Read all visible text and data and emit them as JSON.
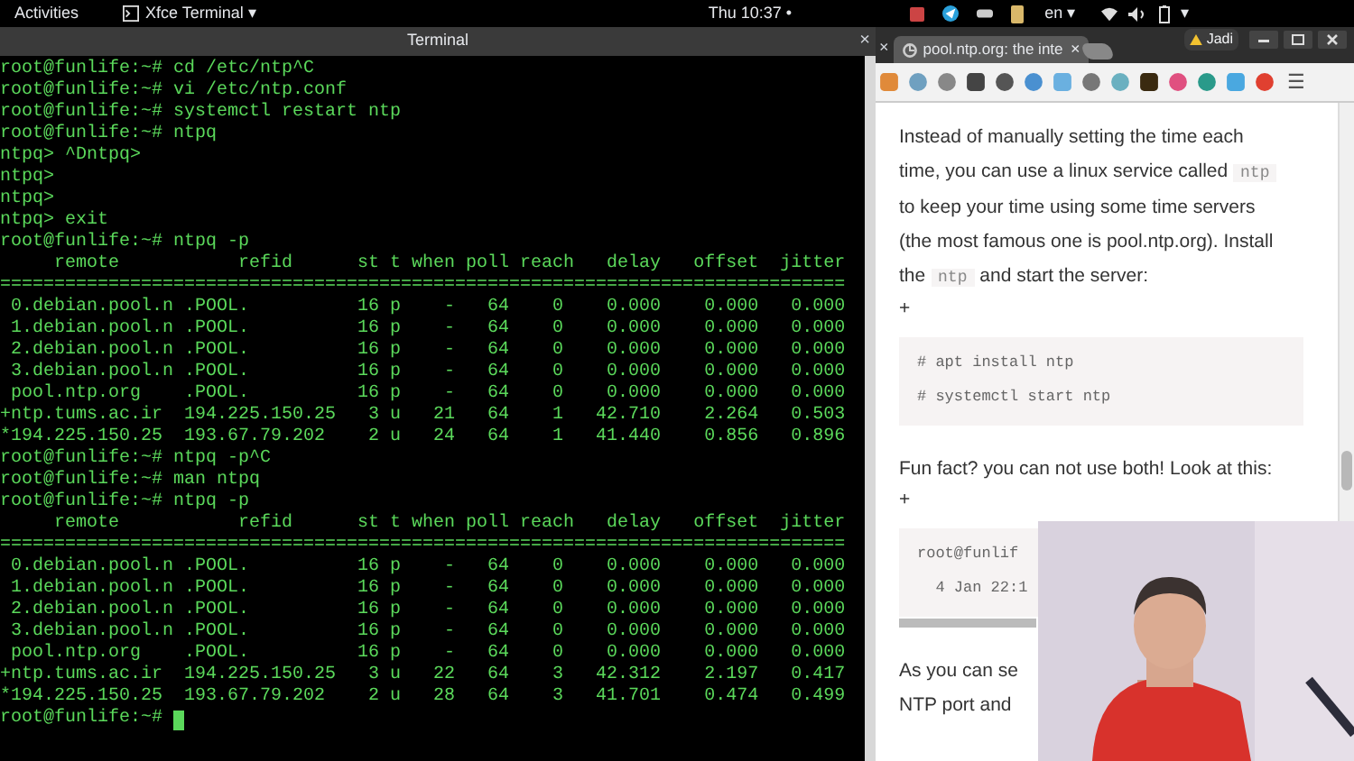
{
  "top_bar": {
    "activities": "Activities",
    "app_menu": "Xfce Terminal ▾",
    "clock": "Thu 10:37 •",
    "language": "en ▾",
    "system_menu": "▾"
  },
  "terminal": {
    "title": "Terminal",
    "close": "×",
    "lines": [
      "root@funlife:~# cd /etc/ntp^C",
      "root@funlife:~# vi /etc/ntp.conf",
      "root@funlife:~# systemctl restart ntp",
      "root@funlife:~# ntpq",
      "ntpq> ^Dntpq>",
      "ntpq>",
      "ntpq>",
      "ntpq> exit",
      "root@funlife:~# ntpq -p",
      "     remote           refid      st t when poll reach   delay   offset  jitter",
      "==============================================================================",
      " 0.debian.pool.n .POOL.          16 p    -   64    0    0.000    0.000   0.000",
      " 1.debian.pool.n .POOL.          16 p    -   64    0    0.000    0.000   0.000",
      " 2.debian.pool.n .POOL.          16 p    -   64    0    0.000    0.000   0.000",
      " 3.debian.pool.n .POOL.          16 p    -   64    0    0.000    0.000   0.000",
      " pool.ntp.org    .POOL.          16 p    -   64    0    0.000    0.000   0.000",
      "+ntp.tums.ac.ir  194.225.150.25   3 u   21   64    1   42.710    2.264   0.503",
      "*194.225.150.25  193.67.79.202    2 u   24   64    1   41.440    0.856   0.896",
      "root@funlife:~# ntpq -p^C",
      "root@funlife:~# man ntpq",
      "root@funlife:~# ntpq -p",
      "     remote           refid      st t when poll reach   delay   offset  jitter",
      "==============================================================================",
      " 0.debian.pool.n .POOL.          16 p    -   64    0    0.000    0.000   0.000",
      " 1.debian.pool.n .POOL.          16 p    -   64    0    0.000    0.000   0.000",
      " 2.debian.pool.n .POOL.          16 p    -   64    0    0.000    0.000   0.000",
      " 3.debian.pool.n .POOL.          16 p    -   64    0    0.000    0.000   0.000",
      " pool.ntp.org    .POOL.          16 p    -   64    0    0.000    0.000   0.000",
      "+ntp.tums.ac.ir  194.225.150.25   3 u   22   64    3   42.312    2.197   0.417",
      "*194.225.150.25  193.67.79.202    2 u   28   64    3   41.701    0.474   0.499"
    ],
    "prompt": "root@funlife:~# "
  },
  "browser": {
    "profile": "Jadi",
    "tab_close_left": "×",
    "tabs": [
      {
        "label": "pool.ntp.org: the inte",
        "close": "×",
        "selected": true
      }
    ],
    "menu": "☰",
    "content": [
      {
        "kind": "paragraph",
        "segments": [
          {
            "text": "Instead of manually setting the time each\ntime, you can use a linux service called ",
            "kind": "text"
          },
          {
            "text": "ntp",
            "kind": "code"
          },
          {
            "text": "\nto keep your time using some time servers\n(the most famous one is pool.ntp.org). Install\nthe ",
            "kind": "text"
          },
          {
            "text": "ntp",
            "kind": "code"
          },
          {
            "text": " and start the server:",
            "kind": "text"
          }
        ]
      },
      {
        "kind": "plus",
        "text": "+"
      },
      {
        "kind": "code",
        "lines": [
          "# apt install ntp",
          "# systemctl start ntp"
        ]
      },
      {
        "kind": "paragraph",
        "segments": [
          {
            "text": "Fun fact? you can not use both! Look at this:",
            "kind": "text"
          }
        ]
      },
      {
        "kind": "plus",
        "text": "+"
      },
      {
        "kind": "code",
        "lines": [
          "root@funlif",
          "  4 Jan 22:1"
        ],
        "scrollbar": true
      },
      {
        "kind": "line",
        "text": "As you can se"
      },
      {
        "kind": "line",
        "text": "NTP port and"
      }
    ]
  }
}
